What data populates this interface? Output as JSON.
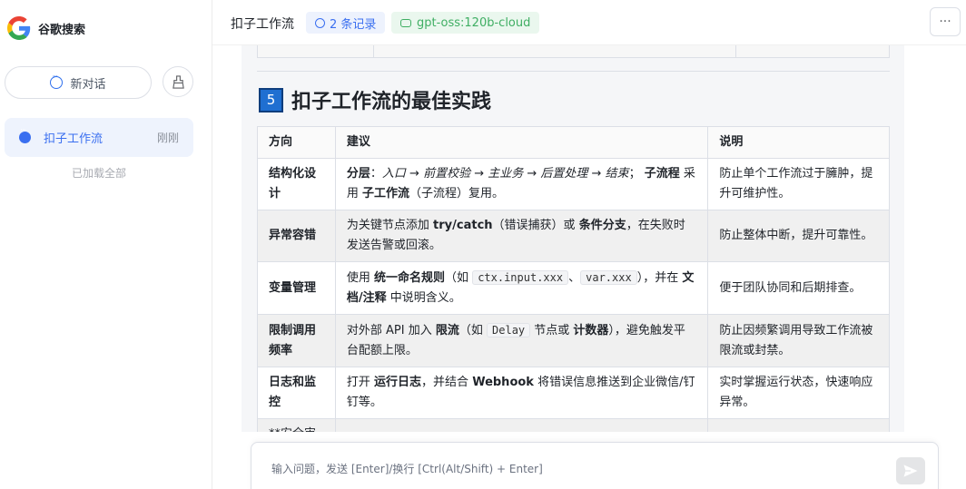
{
  "app": {
    "name": "谷歌搜索"
  },
  "sidebar": {
    "new_chat_label": "新对话",
    "conversations": [
      {
        "title": "扣子工作流",
        "time": "刚刚"
      }
    ],
    "loaded_all": "已加载全部"
  },
  "header": {
    "title": "扣子工作流",
    "records": "2 条记录",
    "model": "gpt-oss:120b-cloud"
  },
  "section": {
    "number": "5",
    "title": "扣子工作流的最佳实践",
    "table": {
      "headers": [
        "方向",
        "建议",
        "说明"
      ],
      "rows": [
        {
          "dir": "结构化设计",
          "s_p1": "分层",
          "s_p2": "：",
          "s_p3": "入口 → 前置校验 → 主业务 → 后置处理 → 结束",
          "s_p4": "；",
          "s_p5": "子流程",
          "s_p6": " 采用 ",
          "s_p7": "子工作流",
          "s_p8": "（子流程）复用。",
          "note": "防止单个工作流过于臃肿，提升可维护性。"
        },
        {
          "dir": "异常容错",
          "s_p1": "为关键节点添加 ",
          "s_p2": "try/catch",
          "s_p3": "（错误捕获）或 ",
          "s_p4": "条件分支",
          "s_p5": "，在失败时发送告警或回滚。",
          "note": "防止整体中断，提升可靠性。"
        },
        {
          "dir": "变量管理",
          "s_p1": "使用 ",
          "s_p2": "统一命名规则",
          "s_p3": "（如 ",
          "s_code1": "ctx.input.xxx",
          "s_p4": "、",
          "s_code2": "var.xxx",
          "s_p5": "），并在 ",
          "s_p6": "文档/注释",
          "s_p7": " 中说明含义。",
          "note": "便于团队协同和后期排查。"
        },
        {
          "dir": "限制调用频率",
          "s_p1": "对外部 API 加入 ",
          "s_p2": "限流",
          "s_p3": "（如 ",
          "s_code1": "Delay",
          "s_p4": " 节点或 ",
          "s_p5": "计数器",
          "s_p6": "），避免触发平台配额上限。",
          "note": "防止因频繁调用导致工作流被限流或封禁。"
        },
        {
          "dir": "日志和监控",
          "s_p1": "打开 ",
          "s_p2": "运行日志",
          "s_p3": "，并结合 ",
          "s_p4": "Webhook",
          "s_p5": " 将错误信息推送到企业微信/钉钉等。",
          "note": "实时掌握运行状态，快速响应异常。"
        },
        {
          "dir": "**安全审"
        }
      ]
    }
  },
  "input": {
    "placeholder": "输入问题，发送 [Enter]/换行 [Ctrl(Alt/Shift) + Enter]"
  },
  "colors": {
    "accent": "#3a6ff0",
    "model_green": "#3fae63",
    "badge_blue": "#1f6fd1"
  }
}
